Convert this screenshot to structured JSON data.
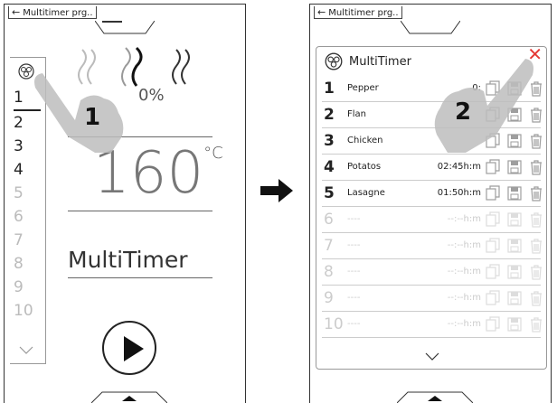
{
  "left_screen": {
    "back_label": "Multitimer prg..",
    "levels": [
      {
        "n": "1",
        "active": true,
        "selected": true
      },
      {
        "n": "2",
        "active": true
      },
      {
        "n": "3",
        "active": true
      },
      {
        "n": "4",
        "active": true
      },
      {
        "n": "5",
        "active": false
      },
      {
        "n": "6",
        "active": false
      },
      {
        "n": "7",
        "active": false
      },
      {
        "n": "8",
        "active": false
      },
      {
        "n": "9",
        "active": false
      },
      {
        "n": "10",
        "active": false
      }
    ],
    "humidity_partial": "0%",
    "temperature": "160",
    "temp_unit": "°C",
    "program_name": "MultiTimer",
    "callout": "1"
  },
  "right_screen": {
    "back_label": "Multitimer prg..",
    "title": "MultiTimer",
    "callout": "2",
    "rows": [
      {
        "n": "1",
        "name": "Pepper",
        "time": "0:",
        "active": true
      },
      {
        "n": "2",
        "name": "Flan",
        "time": "",
        "active": true
      },
      {
        "n": "3",
        "name": "Chicken",
        "time": "",
        "active": true
      },
      {
        "n": "4",
        "name": "Potatos",
        "time": "02:45h:m",
        "active": true
      },
      {
        "n": "5",
        "name": "Lasagne",
        "time": "01:50h:m",
        "active": true
      },
      {
        "n": "6",
        "name": "----",
        "time": "--:--h:m",
        "active": false
      },
      {
        "n": "7",
        "name": "----",
        "time": "--:--h:m",
        "active": false
      },
      {
        "n": "8",
        "name": "----",
        "time": "--:--h:m",
        "active": false
      },
      {
        "n": "9",
        "name": "----",
        "time": "--:--h:m",
        "active": false
      },
      {
        "n": "10",
        "name": "----",
        "time": "--:--h:m",
        "active": false
      }
    ]
  },
  "colors": {
    "close": "#e53935",
    "inactive": "#cccccc",
    "text": "#222222"
  }
}
